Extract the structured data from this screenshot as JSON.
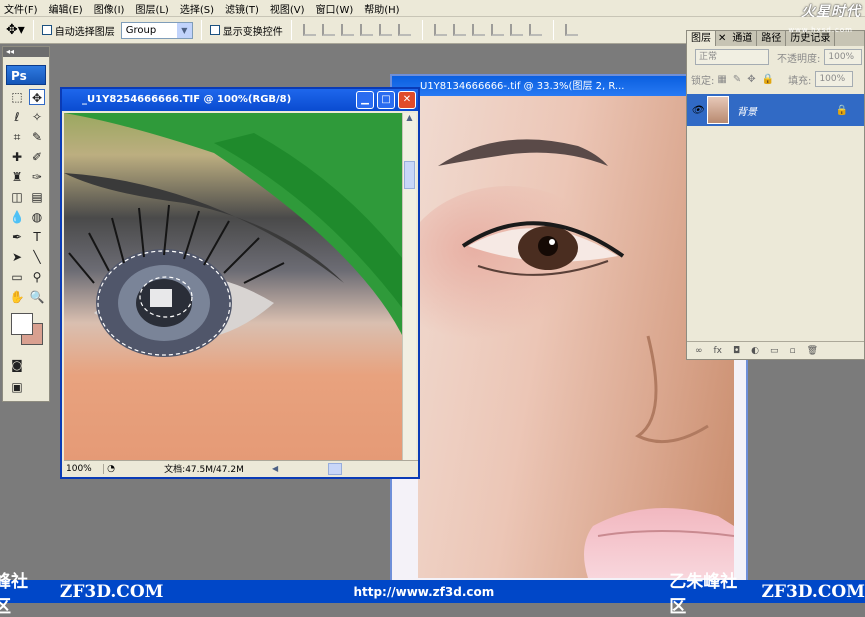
{
  "menu": [
    "文件(F)",
    "编辑(E)",
    "图像(I)",
    "图层(L)",
    "选择(S)",
    "滤镜(T)",
    "视图(V)",
    "窗口(W)",
    "帮助(H)"
  ],
  "logo": "火星时代",
  "logo_sub": "www.hxsd.com",
  "options": {
    "auto_select_label": "自动选择图层",
    "group_value": "Group",
    "show_transform_label": "显示变换控件"
  },
  "tools_header": "◂◂",
  "ps_badge": "Ps",
  "doc_left": {
    "title": "_U1Y8254666666.TIF @ 100%(RGB/8)",
    "zoom": "100%",
    "doc_size": "文档:47.5M/47.2M"
  },
  "doc_right": {
    "title": "U1Y8134666666-.tif @ 33.3%(图层 2, R..."
  },
  "layers_panel": {
    "tabs": [
      "图层",
      "通道",
      "路径",
      "历史记录"
    ],
    "blend_mode": "正常",
    "opacity_label": "不透明度:",
    "opacity_value": "100%",
    "lock_label": "锁定:",
    "fill_label": "填充:",
    "fill_value": "100%",
    "layer_name": "背景",
    "bottom_icons": [
      "∞",
      "fx",
      "◘",
      "◐",
      "▭",
      "▫",
      "🗑"
    ]
  },
  "footer": {
    "left_text": "峰社区",
    "left_url": "ZF3D.COM",
    "center_url": "http://www.zf3d.com",
    "right_text": "乙朱峰社区",
    "right_url": "ZF3D.COM"
  }
}
